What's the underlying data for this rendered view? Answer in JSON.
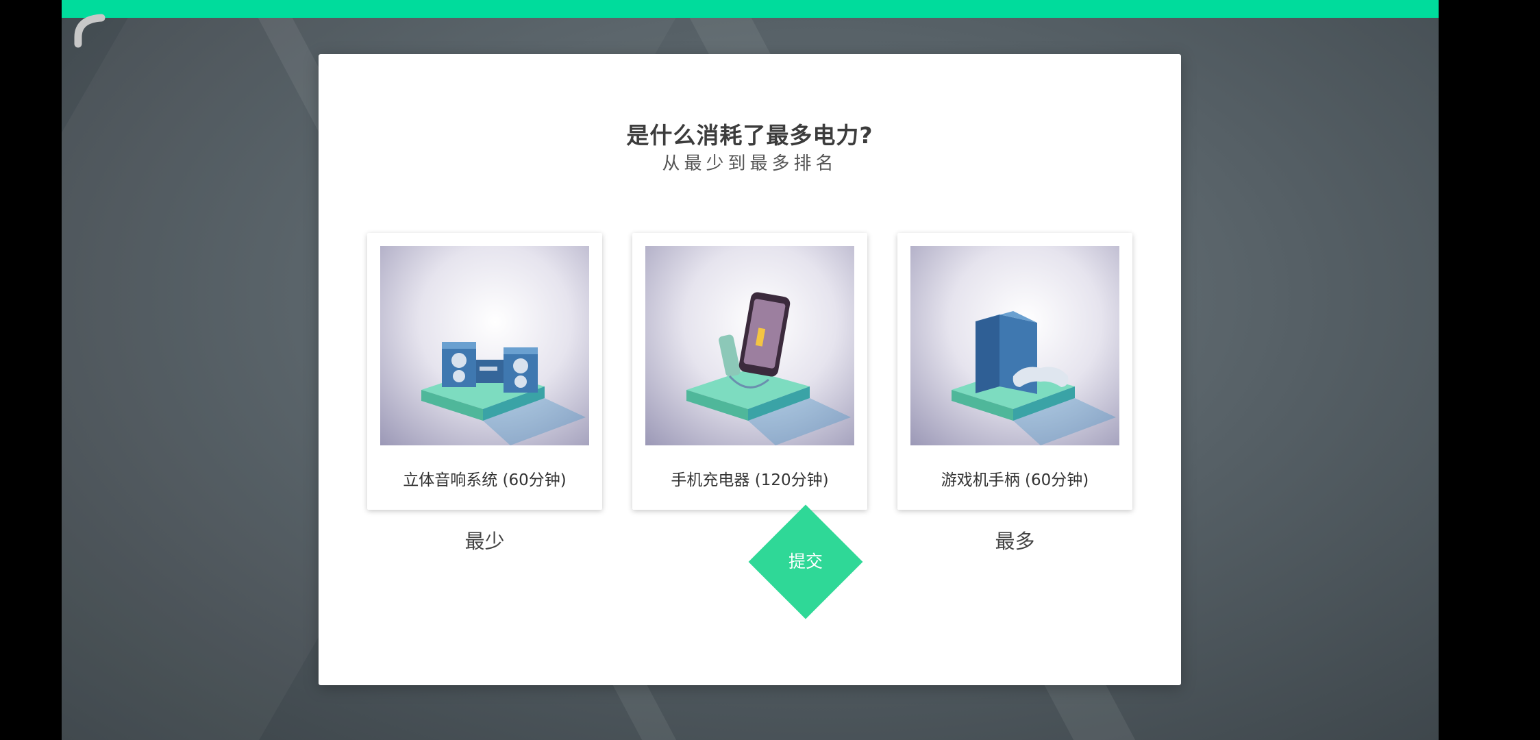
{
  "question": {
    "title": "是什么消耗了最多电力?",
    "subtitle": "从最少到最多排名"
  },
  "cards": [
    {
      "label": "立体音响系统 (60分钟)",
      "icon": "stereo-system-icon"
    },
    {
      "label": "手机充电器 (120分钟)",
      "icon": "phone-charger-icon"
    },
    {
      "label": "游戏机手柄 (60分钟)",
      "icon": "game-console-icon"
    }
  ],
  "rank": {
    "least": "最少",
    "most": "最多"
  },
  "submit": {
    "label": "提交"
  },
  "colors": {
    "accent": "#00dc9c",
    "button": "#2fd897",
    "platform": "#6fd3b6"
  }
}
